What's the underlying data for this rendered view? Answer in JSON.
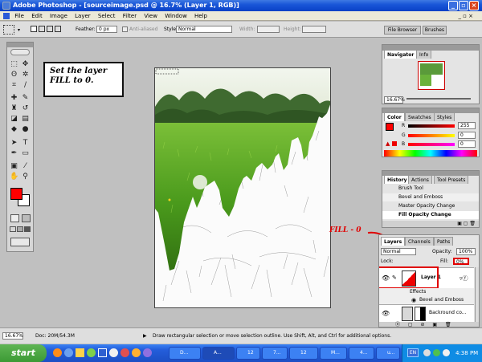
{
  "window": {
    "title": "Adobe Photoshop - [sourceimage.psd @ 16.7% (Layer 1, RGB)]"
  },
  "menu": [
    "File",
    "Edit",
    "Image",
    "Layer",
    "Select",
    "Filter",
    "View",
    "Window",
    "Help"
  ],
  "options": {
    "feather_label": "Feather:",
    "feather_value": "0 px",
    "antialiased": "Anti-aliased",
    "style_label": "Style:",
    "style_value": "Normal",
    "width_label": "Width:",
    "height_label": "Height:",
    "palette_well": [
      "File Browser",
      "Brushes"
    ]
  },
  "annotation": {
    "note": "Set the layer FILL to 0.",
    "fill_callout": "FILL - 0"
  },
  "navigator": {
    "tabs": [
      "Navigator",
      "Info"
    ],
    "zoom": "16.67%"
  },
  "color": {
    "tabs": [
      "Color",
      "Swatches",
      "Styles"
    ],
    "channels": [
      {
        "label": "R",
        "value": "255"
      },
      {
        "label": "G",
        "value": "0"
      },
      {
        "label": "B",
        "value": "0"
      }
    ]
  },
  "history": {
    "tabs": [
      "History",
      "Actions",
      "Tool Presets"
    ],
    "items": [
      "Brush Tool",
      "Bevel and Emboss",
      "Master Opacity Change",
      "Fill Opacity Change"
    ]
  },
  "layers": {
    "tabs": [
      "Layers",
      "Channels",
      "Paths"
    ],
    "blend": "Normal",
    "opacity_label": "Opacity:",
    "opacity_value": "100%",
    "lock_label": "Lock:",
    "fill_label": "Fill:",
    "fill_value": "0%",
    "items": {
      "layer1": "Layer 1",
      "effects": "Effects",
      "bevel": "Bevel and Emboss",
      "background": "Backround co..."
    }
  },
  "status": {
    "zoom": "16.67%",
    "doc": "Doc: 20M/54.3M",
    "hint": "Draw rectangular selection or move selection outline. Use Shift, Alt, and Ctrl for additional options."
  },
  "taskbar": {
    "start": "start",
    "buttons": [
      "D...",
      "A...",
      "12",
      "7...",
      "12",
      "M...",
      "4...",
      "u..."
    ],
    "lang": "EN",
    "time": "4:38 PM"
  },
  "colors": {
    "accent_red": "#e00000",
    "fg_swatch": "#ff0000",
    "xp_blue": "#245edb",
    "start_green": "#3c9a35",
    "layer_selected": "#0a246a"
  }
}
